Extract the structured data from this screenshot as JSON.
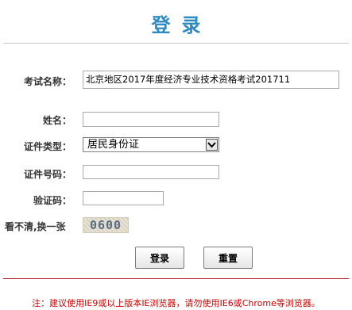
{
  "header": {
    "title": "登录"
  },
  "form": {
    "exam_name_label": "考试名称：",
    "exam_name_value": "北京地区2017年度经济专业技术资格考试201711",
    "name_label": "姓名：",
    "name_value": "",
    "id_type_label": "证件类型：",
    "id_type_selected": "居民身份证",
    "id_number_label": "证件号码：",
    "id_number_value": "",
    "captcha_label": "验证码：",
    "captcha_value": "",
    "captcha_refresh_label": "看不清,换一张",
    "captcha_code": "0600"
  },
  "buttons": {
    "login": "登录",
    "reset": "重置"
  },
  "footer": {
    "notice": "注：建议使用IE9或以上版本IE浏览器，请勿使用IE6或Chrome等浏览器。"
  },
  "colors": {
    "title": "#2e8bc0",
    "notice": "#d00000",
    "divider_bottom": "#b0141e"
  }
}
